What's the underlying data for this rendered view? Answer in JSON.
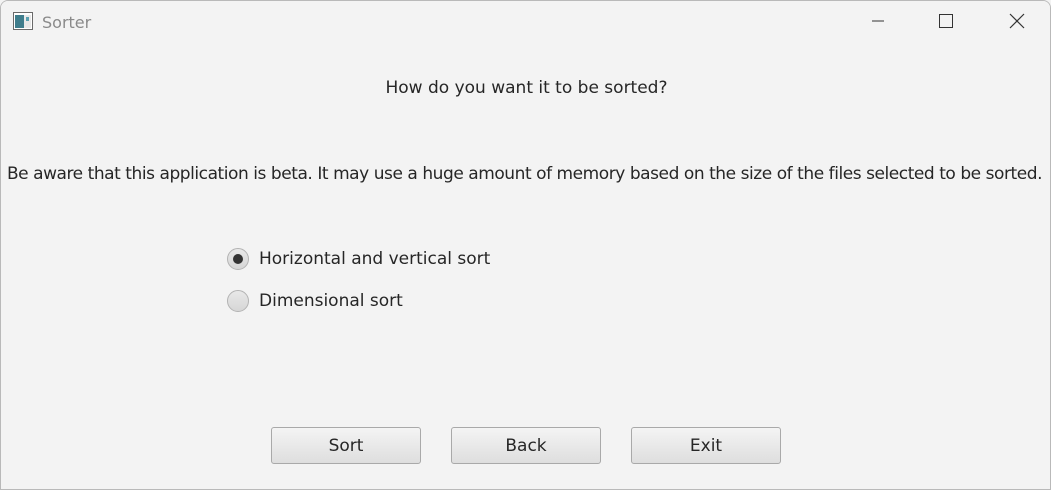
{
  "window": {
    "title": "Sorter",
    "icon": "java-app-icon",
    "controls": {
      "minimize_icon": "minimize-icon",
      "maximize_icon": "maximize-icon",
      "close_icon": "close-icon"
    }
  },
  "content": {
    "question": "How do you want it to be sorted?",
    "warning": "Be aware that this application is beta. It may use a huge amount of memory based on the size of the files selected to be sorted.",
    "options": [
      {
        "label": "Horizontal and vertical sort",
        "selected": true
      },
      {
        "label": "Dimensional sort",
        "selected": false
      }
    ]
  },
  "buttons": {
    "sort": "Sort",
    "back": "Back",
    "exit": "Exit"
  },
  "colors": {
    "background": "#f3f3f3",
    "text": "#262626",
    "title_text": "#8a8a8a"
  }
}
